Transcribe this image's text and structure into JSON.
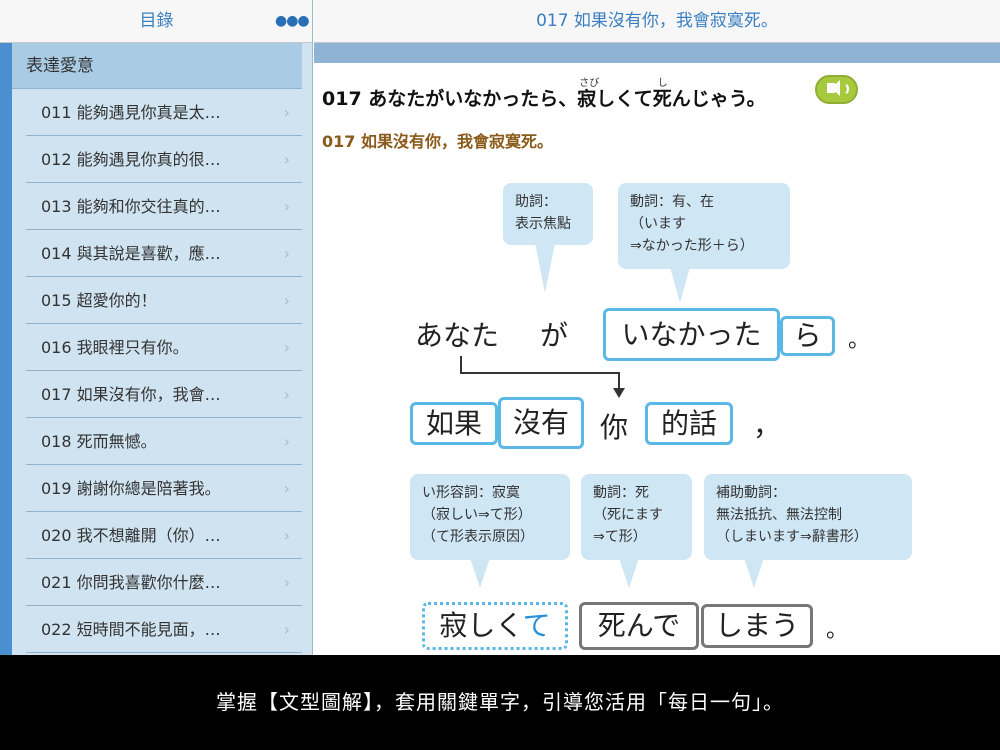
{
  "sidebar": {
    "title": "目錄",
    "more_icon": "more-icon",
    "category": "表達愛意",
    "items": [
      {
        "label": "011 能夠遇見你真是太…"
      },
      {
        "label": "012 能夠遇見你真的很…"
      },
      {
        "label": "013 能夠和你交往真的…"
      },
      {
        "label": "014 與其說是喜歡，應…"
      },
      {
        "label": "015 超愛你的！"
      },
      {
        "label": "016 我眼裡只有你。"
      },
      {
        "label": "017 如果沒有你，我會…"
      },
      {
        "label": "018 死而無憾。"
      },
      {
        "label": "019 謝謝你總是陪著我。"
      },
      {
        "label": "020 我不想離開（你）…"
      },
      {
        "label": "021 你問我喜歡你什麼…"
      },
      {
        "label": "022 短時間不能見面，…"
      }
    ],
    "chevron": "›"
  },
  "main": {
    "title": "017 如果沒有你，我會寂寞死。",
    "jp_sentence": {
      "part1": "017 あなたがいなかったら、",
      "k1": "寂",
      "part2": "しくて",
      "k2": "死",
      "part3": "んじゃう。",
      "ruby1": "さび",
      "ruby2": "し"
    },
    "sound_icon": "speaker-icon",
    "zh_sentence": "017 如果沒有你，我會寂寞死。",
    "diagram": {
      "bubble_joshi": [
        "助詞：",
        "表示焦點"
      ],
      "bubble_doushi": [
        "動詞：有、在",
        "（います",
        "⇒なかった形＋ら）"
      ],
      "anata": "あなた",
      "ga": "が",
      "inakatta": "いなかった",
      "ra": "ら",
      "maru1": "。",
      "ruguo": "如果",
      "meiyou": "沒有",
      "ni": "你",
      "dehua": "的話",
      "comma": "，",
      "bubble_keiyoushi": [
        "い形容詞：寂寞",
        "（寂しい⇒て形）",
        "（て形表示原因）"
      ],
      "bubble_doushi2": [
        "動詞：死",
        "（死にます",
        "⇒て形）"
      ],
      "bubble_hojo": [
        "補助動詞：",
        "無法抵抗、無法控制",
        "（しまいます⇒辭書形）"
      ],
      "sabishikute_a": "寂しく",
      "sabishikute_b": "て",
      "shinde": "死んで",
      "shimau": "しまう",
      "maru2": "。"
    }
  },
  "caption": "掌握【文型圖解】，套用關鍵單字，引導您活用「每日一句」。",
  "colors": {
    "accent_blue": "#3a7fc1",
    "box_blue": "#5bb7e6",
    "bubble_bg": "#cfe6f4",
    "zh_brown": "#8a5a1a",
    "sound_green": "#a6c93e"
  }
}
